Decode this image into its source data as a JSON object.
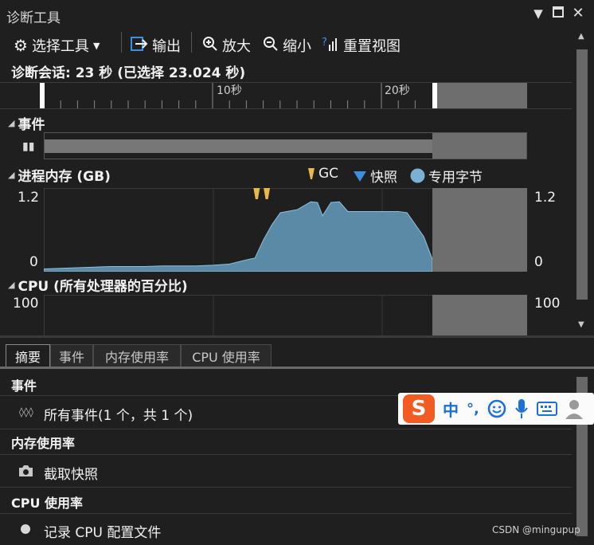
{
  "window": {
    "title": "诊断工具"
  },
  "toolbar": {
    "select_tools": "选择工具",
    "output": "输出",
    "zoom_in": "放大",
    "zoom_out": "缩小",
    "reset_view": "重置视图"
  },
  "session": {
    "text": "诊断会话: 23 秒 (已选择 23.024 秒)"
  },
  "timeline": {
    "ticks": [
      "10秒",
      "20秒"
    ]
  },
  "events_section": {
    "title": "事件"
  },
  "memory_section": {
    "title": "进程内存 (GB)",
    "legend": [
      "GC",
      "快照",
      "专用字节"
    ],
    "y_max": "1.2",
    "y_min": "0"
  },
  "cpu_section": {
    "title": "CPU (所有处理器的百分比)",
    "y_max": "100"
  },
  "tabs": [
    "摘要",
    "事件",
    "内存使用率",
    "CPU 使用率"
  ],
  "summary": {
    "events_head": "事件",
    "events_item": "所有事件(1 个，共 1 个)",
    "memory_head": "内存使用率",
    "memory_item": "截取快照",
    "cpu_head": "CPU 使用率",
    "cpu_item": "记录 CPU 配置文件"
  },
  "ime": {
    "zh": "中",
    "punct": "°,"
  },
  "watermark": "CSDN @mingupup",
  "colors": {
    "area": "#5a8aa6",
    "gc": "#e8b84a",
    "snapshot": "#3e8ee0",
    "private_bytes": "#7ab0d0",
    "selection_gray": "#6e6e6e"
  },
  "chart_data": {
    "type": "area",
    "title": "进程内存 (GB)",
    "xlabel": "",
    "ylabel": "",
    "ylim": [
      0,
      1.2
    ],
    "xlim": [
      0,
      23
    ],
    "x_tick_labels": [
      "10秒",
      "20秒"
    ],
    "series": [
      {
        "name": "专用字节",
        "x": [
          0,
          1,
          2,
          3,
          4,
          5,
          6,
          7,
          8,
          9,
          10,
          11,
          12,
          12.5,
          13,
          13.5,
          14,
          15,
          15.8,
          16.2,
          16.5,
          17,
          17.5,
          18,
          19,
          20,
          21,
          21.5,
          22.5,
          23
        ],
        "values": [
          0.02,
          0.03,
          0.04,
          0.05,
          0.06,
          0.06,
          0.06,
          0.07,
          0.07,
          0.07,
          0.08,
          0.1,
          0.17,
          0.2,
          0.5,
          0.75,
          0.95,
          1.0,
          1.13,
          1.12,
          0.9,
          1.12,
          1.13,
          0.97,
          0.97,
          0.97,
          0.97,
          0.95,
          0.55,
          0.18
        ]
      }
    ],
    "gc_events_x": [
      12.6,
      13.2
    ]
  }
}
